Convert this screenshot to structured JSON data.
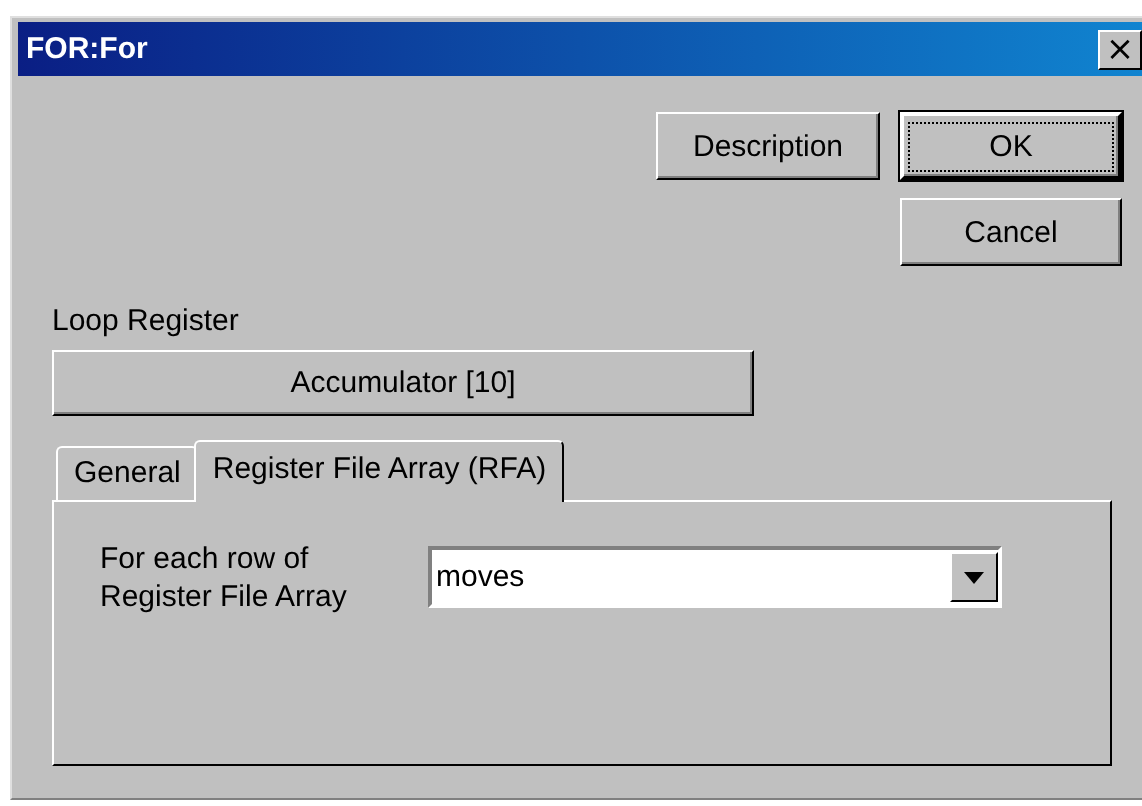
{
  "window": {
    "title": "FOR:For",
    "close": "×"
  },
  "buttons": [
    {
      "label": "Description",
      "default": false
    },
    {
      "label": "OK",
      "default": true
    },
    {
      "label": "Cancel",
      "default": false
    }
  ],
  "loop_register": {
    "label": "Loop Register",
    "value": "Accumulator [10]"
  },
  "tabs": [
    {
      "label": "General",
      "selected": false
    },
    {
      "label": "Register File Array (RFA)",
      "selected": true
    }
  ],
  "rfa": {
    "label": "For each row of Register File Array",
    "value": "moves"
  }
}
